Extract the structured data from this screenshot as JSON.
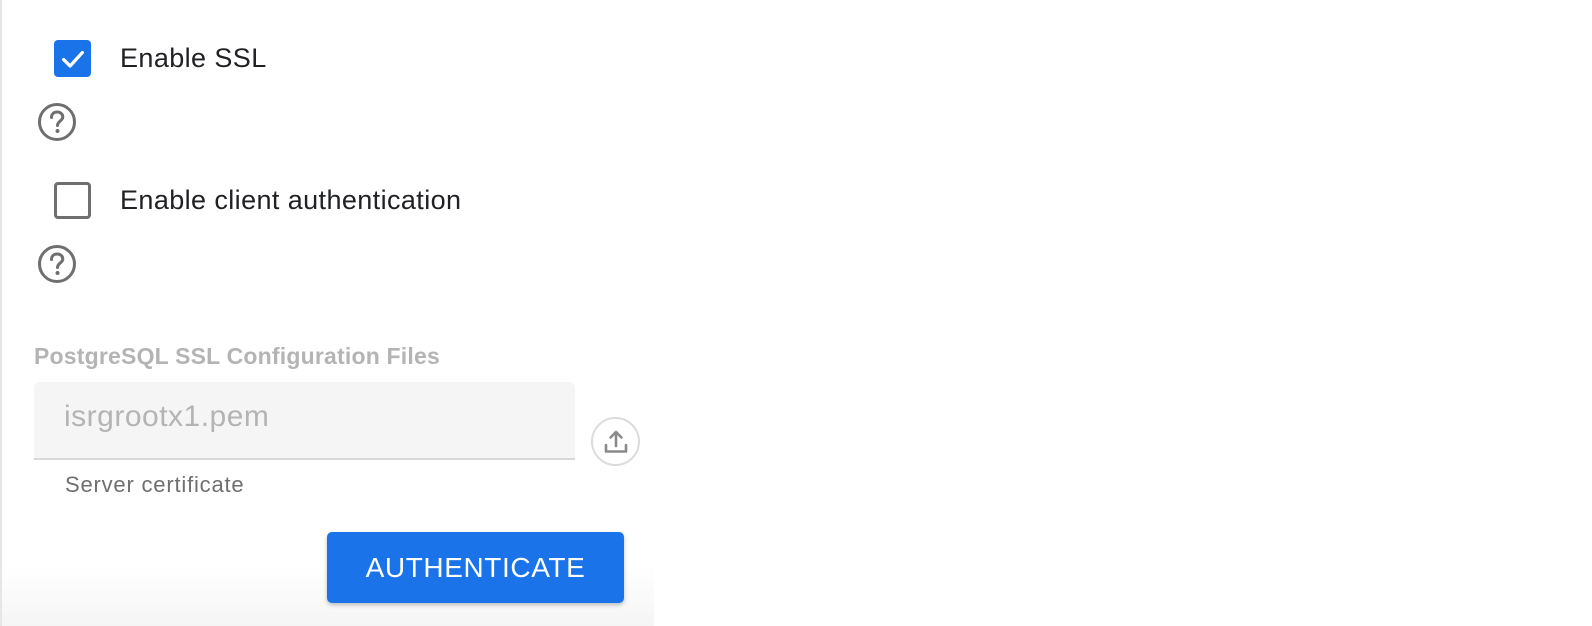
{
  "ssl": {
    "label": "Enable SSL",
    "checked": true,
    "help_icon": "help-circle-icon"
  },
  "client_auth": {
    "label": "Enable client authentication",
    "checked": false,
    "help_icon": "help-circle-icon"
  },
  "config_files": {
    "title": "PostgreSQL SSL Configuration Files",
    "server_certificate": {
      "value": "isrgrootx1.pem",
      "helper": "Server certificate",
      "upload_icon": "upload-icon"
    }
  },
  "actions": {
    "authenticate_label": "AUTHENTICATE"
  },
  "colors": {
    "accent": "#1a73e8",
    "disabled_text": "#b4b4b4",
    "help_icon": "#6f6f6f"
  }
}
